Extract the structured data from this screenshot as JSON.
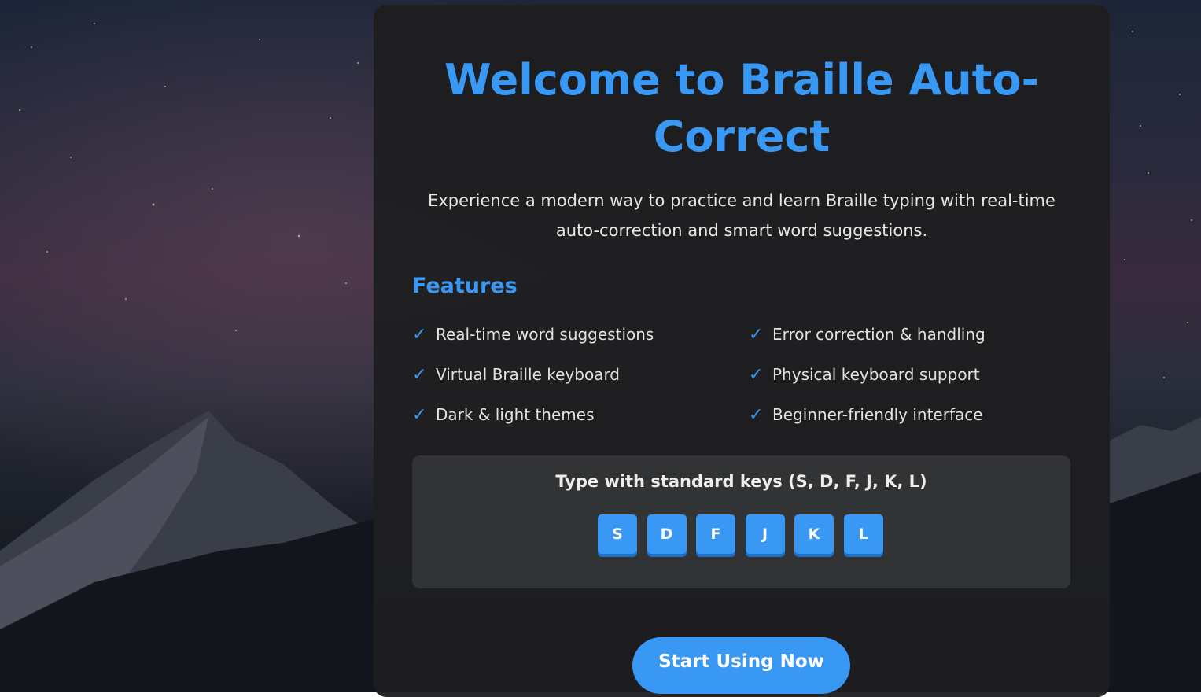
{
  "title_line1": "Welcome to Braille Auto-",
  "title_line2": "Correct",
  "subtitle_line1": "Experience a modern way to practice and learn Braille typing with real-time",
  "subtitle_line2": "auto-correction and smart word suggestions.",
  "features": {
    "heading": "Features",
    "check_icon": "✓",
    "items": [
      "Real-time word suggestions",
      "Error correction & handling",
      "Virtual Braille keyboard",
      "Physical keyboard support",
      "Dark & light themes",
      "Beginner-friendly interface"
    ]
  },
  "keys_panel": {
    "title": "Type with standard keys (S, D, F, J, K, L)",
    "keys": [
      "S",
      "D",
      "F",
      "J",
      "K",
      "L"
    ]
  },
  "start_button": "Start Using Now",
  "colors": {
    "accent": "#3a98f5",
    "card": "#1e1e20",
    "panel": "#323334"
  }
}
